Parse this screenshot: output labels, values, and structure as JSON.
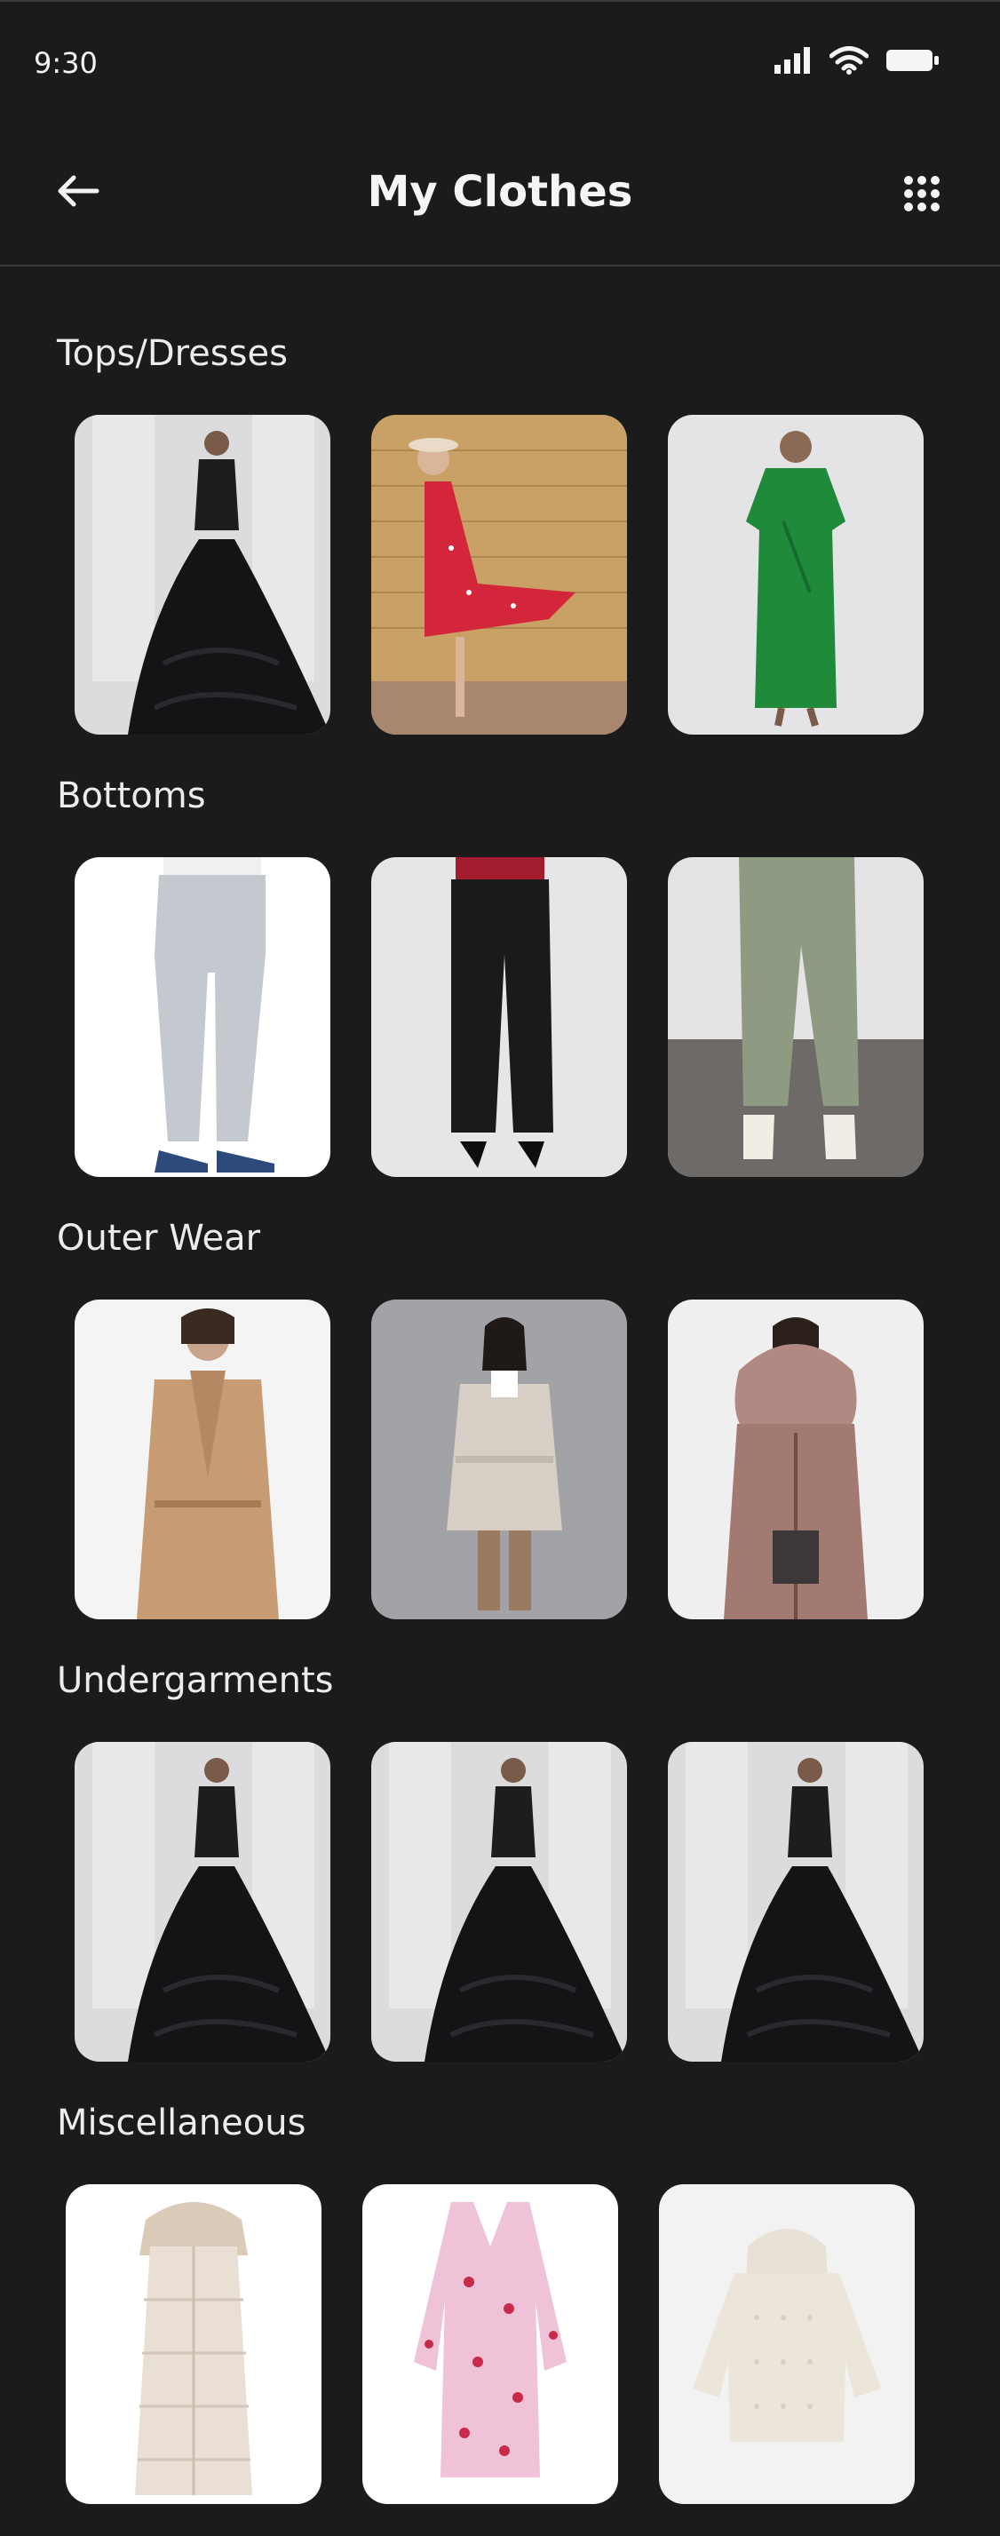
{
  "status_bar": {
    "time": "9:30",
    "icons": [
      "signal-icon",
      "wifi-icon",
      "battery-icon"
    ]
  },
  "header": {
    "title": "My Clothes",
    "back_icon": "arrow-left-icon",
    "menu_icon": "grid-dots-icon"
  },
  "sections": [
    {
      "title": "Tops/Dresses",
      "items": [
        {
          "image": "black-ruffled-gown-photo"
        },
        {
          "image": "red-floral-dress-photo"
        },
        {
          "image": "green-satin-dress-photo"
        }
      ]
    },
    {
      "title": "Bottoms",
      "items": [
        {
          "image": "light-grey-jeans-photo"
        },
        {
          "image": "black-trousers-photo"
        },
        {
          "image": "sage-cargo-pants-photo"
        }
      ]
    },
    {
      "title": "Outer Wear",
      "items": [
        {
          "image": "camel-wrap-coat-photo"
        },
        {
          "image": "beige-belted-coat-photo"
        },
        {
          "image": "pink-fur-hood-parka-photo"
        }
      ]
    },
    {
      "title": "Undergarments",
      "items": [
        {
          "image": "black-ruffled-gown-photo"
        },
        {
          "image": "black-ruffled-gown-photo"
        },
        {
          "image": "black-ruffled-gown-photo"
        }
      ]
    },
    {
      "title": "Miscellaneous",
      "items": [
        {
          "image": "cream-puffer-coat-photo"
        },
        {
          "image": "pink-floral-mini-dress-photo"
        },
        {
          "image": "cream-quilted-jacket-photo"
        }
      ]
    }
  ],
  "colors": {
    "background": "#1b1b1c",
    "text": "#f2f2f2",
    "divider": "#3b3b3c"
  }
}
